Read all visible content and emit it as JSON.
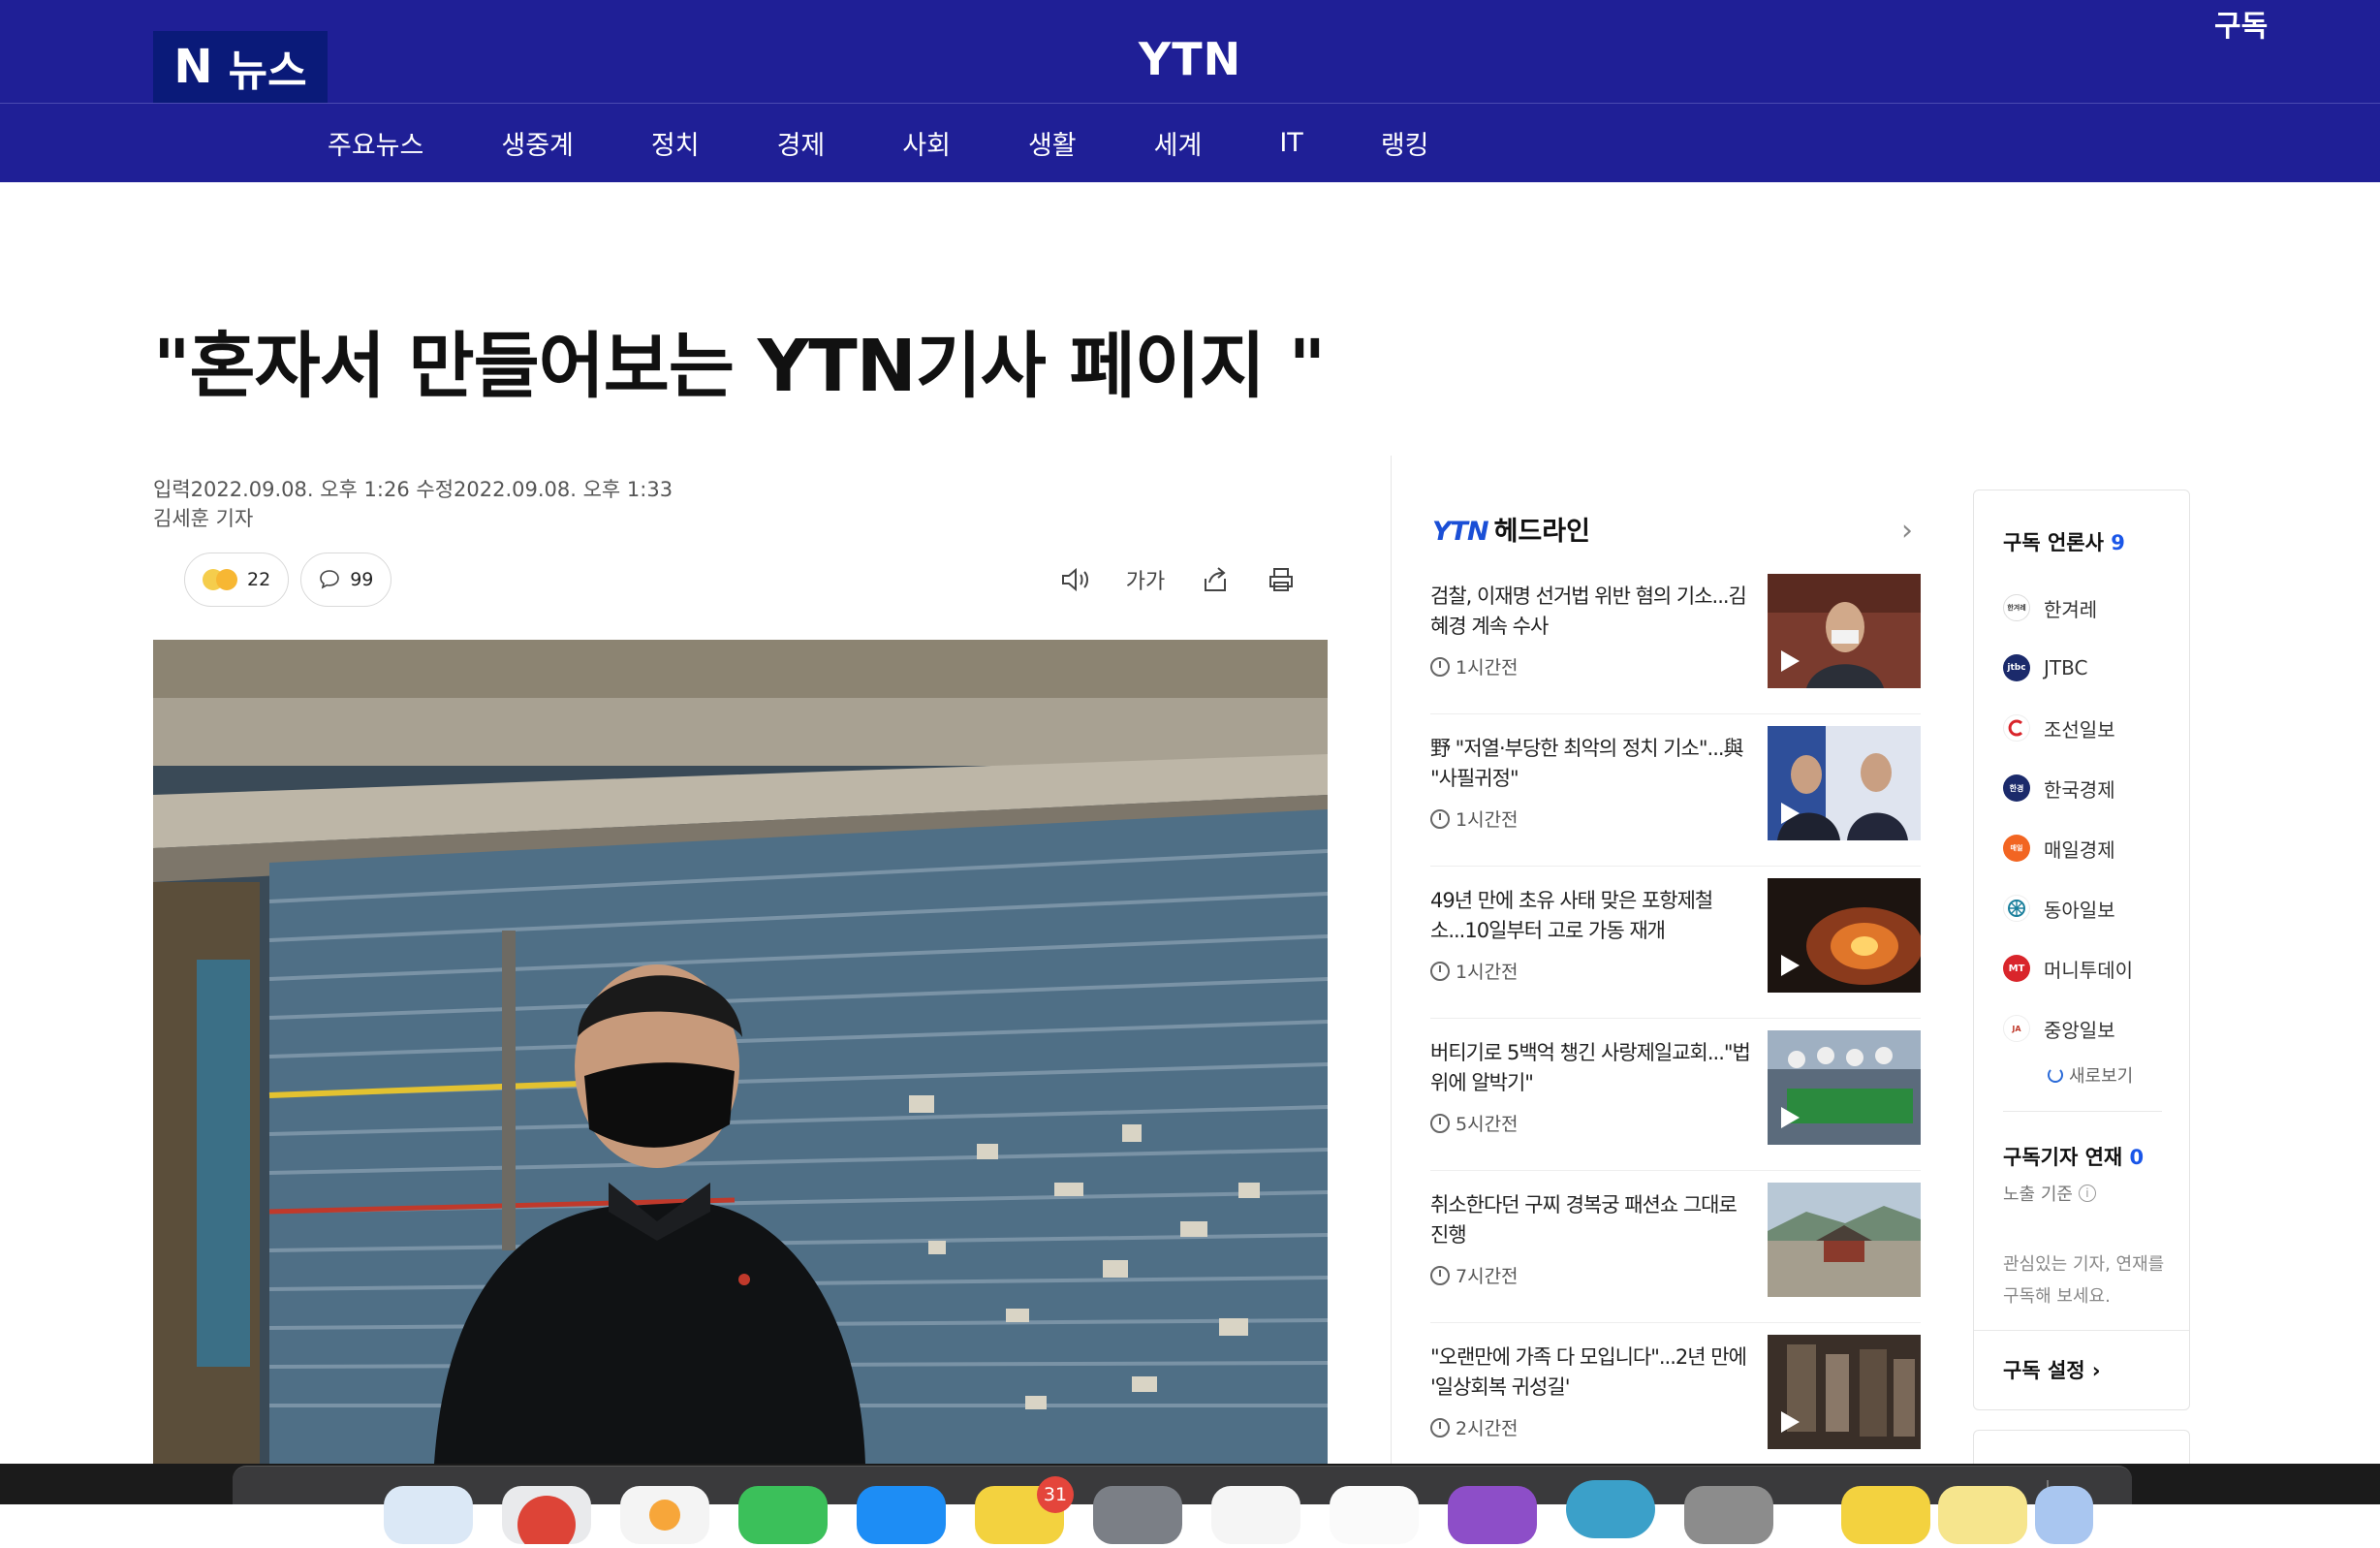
{
  "header": {
    "logo_n": "N",
    "logo_text": "뉴스",
    "brand": "YTN",
    "subscribe": "구독"
  },
  "nav": {
    "items": [
      "주요뉴스",
      "생중계",
      "정치",
      "경제",
      "사회",
      "생활",
      "세계",
      "IT",
      "랭킹"
    ]
  },
  "article": {
    "headline": "\"혼자서 만들어보는 YTN기사 페이지 \"",
    "dates": "입력2022.09.08. 오후 1:26 수정2022.09.08. 오후 1:33",
    "reporter": "김세훈 기자",
    "reaction_count": "22",
    "comment_count": "99",
    "font_size_label": "가가"
  },
  "headlines": {
    "brand": "YTN",
    "title": "헤드라인",
    "more": "›",
    "items": [
      {
        "title": "검찰, 이재명 선거법 위반 혐의 기소...김혜경 계속 수사",
        "time": "1시간전"
      },
      {
        "title": "野 \"저열·부당한 최악의 정치 기소\"...與 \"사필귀정\"",
        "time": "1시간전"
      },
      {
        "title": "49년 만에 초유 사태 맞은 포항제철소...10일부터 고로 가동 재개",
        "time": "1시간전"
      },
      {
        "title": "버티기로 5백억 챙긴 사랑제일교회...\"법 위에 알박기\"",
        "time": "5시간전"
      },
      {
        "title": "취소한다던 구찌 경복궁 패션쇼 그대로 진행",
        "time": "7시간전"
      },
      {
        "title": "\"오랜만에 가족 다 모입니다\"...2년 만에 '일상회복 귀성길'",
        "time": "2시간전"
      }
    ]
  },
  "subscribe_panel": {
    "press_heading": "구독 언론사",
    "press_count": "9",
    "press": [
      {
        "name": "한겨레",
        "color": "#ffffff"
      },
      {
        "name": "JTBC",
        "color": "#1b2a6b"
      },
      {
        "name": "조선일보",
        "color": "#ffffff"
      },
      {
        "name": "한국경제",
        "color": "#1b2a6b"
      },
      {
        "name": "매일경제",
        "color": "#f26522"
      },
      {
        "name": "동아일보",
        "color": "#ffffff"
      },
      {
        "name": "머니투데이",
        "color": "#d9252b"
      },
      {
        "name": "중앙일보",
        "color": "#ffffff"
      }
    ],
    "refresh": "새로보기",
    "reporter_heading": "구독기자  연재",
    "reporter_count": "0",
    "expose": "노출 기준",
    "hint": "관심있는 기자, 연재를 구독해 보세요.",
    "setting": "구독 설정 ›"
  },
  "dock": {
    "calendar_badge": "31"
  },
  "colors": {
    "header_bg": "#1f1f96",
    "logo_bg": "#0a1a79",
    "accent_blue": "#1a56e8"
  }
}
